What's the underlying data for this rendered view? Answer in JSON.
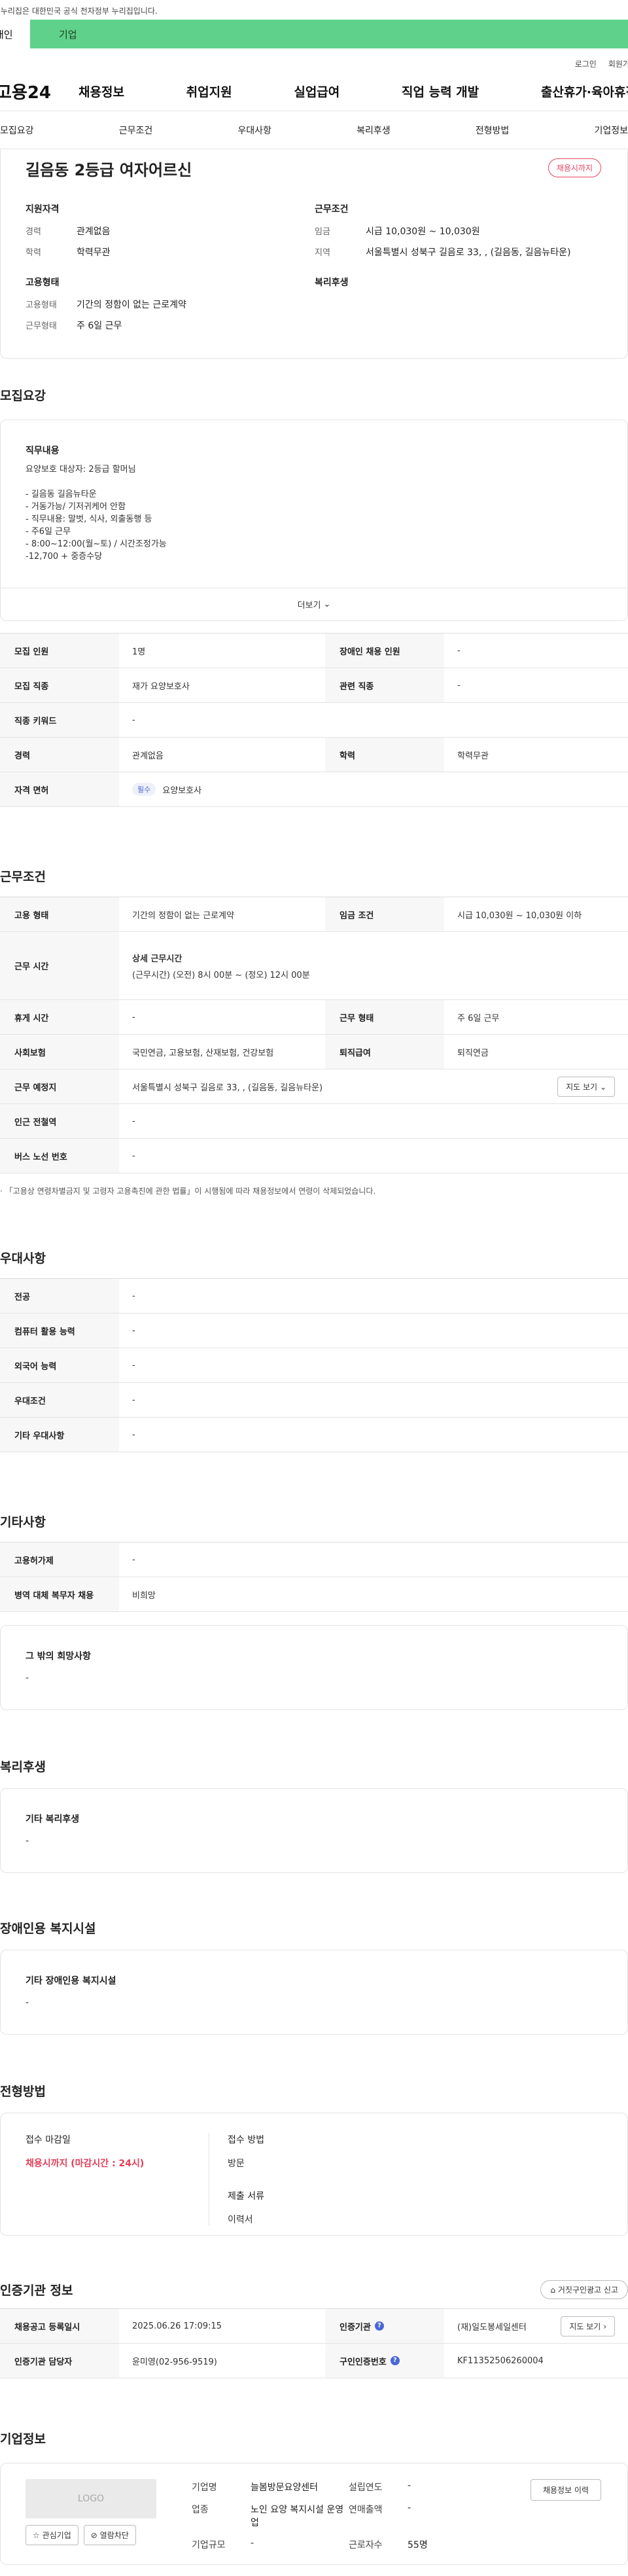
{
  "banner": {
    "text": "이 누리집은 대한민국 공식 전자정부 누리집입니다."
  },
  "tabs": {
    "person": "개인",
    "company": "기업"
  },
  "util": {
    "login": "로그인",
    "join": "회원가입"
  },
  "gnb": {
    "logo": "고용24",
    "items": [
      "채용정보",
      "취업지원",
      "실업급여",
      "직업 능력 개발",
      "출산휴가·육아휴직"
    ]
  },
  "subnav": [
    "모집요강",
    "근무조건",
    "우대사항",
    "복리후생",
    "전형방법",
    "기업정보"
  ],
  "summary": {
    "title": "길음동 2등급 여자어르신",
    "deadline": "채용시까지",
    "qualification_head": "지원자격",
    "qual_rows": [
      {
        "k": "경력",
        "v": "관계없음"
      },
      {
        "k": "학력",
        "v": "학력무관"
      }
    ],
    "employment_head": "고용형태",
    "emp_rows": [
      {
        "k": "고용형태",
        "v": "기간의 정함이 없는 근로계약"
      },
      {
        "k": "근무형태",
        "v": "주 6일 근무"
      }
    ],
    "conditions_head": "근무조건",
    "cond_rows": [
      {
        "k": "임금",
        "v": "시급 10,030원 ~ 10,030원"
      },
      {
        "k": "지역",
        "v": "서울특별시 성북구 길음로 33, , (길음동, 길음뉴타운)"
      }
    ],
    "welfare_head": "복리후생"
  },
  "recruit": {
    "title": "모집요강",
    "job_head": "직무내용",
    "job_lines": [
      "요양보호 대상자:  2등급 할머님",
      "",
      "- 길음동 길음뉴타운",
      "- 거동가능/ 기저귀케어 안함",
      "- 직무내용: 말벗, 식사, 외출동행 등",
      "- 주6일 근무",
      "- 8:00~12:00(월~토) / 시간조정가능",
      "-12,700 + 중증수당"
    ],
    "more": "더보기",
    "rows": {
      "count_k": "모집 인원",
      "count_v": "1명",
      "disabled_k": "장애인 채용 인원",
      "disabled_v": "-",
      "job_k": "모집 직종",
      "job_v": "재가 요양보호사",
      "related_k": "관련 직종",
      "related_v": "-",
      "keyword_k": "직종 키워드",
      "keyword_v": "-",
      "career_k": "경력",
      "career_v": "관계없음",
      "edu_k": "학력",
      "edu_v": "학력무관",
      "license_k": "자격 면허",
      "license_chip": "필수",
      "license_v": "요양보호사"
    }
  },
  "conditions": {
    "title": "근무조건",
    "type_k": "고용 형태",
    "type_v": "기간의 정함이 없는 근로계약",
    "wage_k": "임금 조건",
    "wage_v": "시급 10,030원 ~ 10,030원 이하",
    "hours_k": "근무 시간",
    "hours_head": "상세 근무시간",
    "hours_v": "(근무시간) (오전) 8시 00분 ~ (정오) 12시 00분",
    "rest_k": "휴게 시간",
    "rest_v": "-",
    "form_k": "근무 형태",
    "form_v": "주 6일 근무",
    "insurance_k": "사회보험",
    "insurance_v": "국민연금, 고용보험, 산재보험, 건강보험",
    "retire_k": "퇴직급여",
    "retire_v": "퇴직연금",
    "place_k": "근무 예정지",
    "place_v": "서울특별시 성북구 길음로 33, , (길음동, 길음뉴타운)",
    "map": "지도 보기",
    "station_k": "인근 전철역",
    "station_v": "-",
    "bus_k": "버스 노선 번호",
    "bus_v": "-",
    "note": "「고용상 연령차별금지 및 고령자 고용촉진에 관한 법률」이 시행됨에 따라 채용정보에서 연령이 삭제되었습니다."
  },
  "preference": {
    "title": "우대사항",
    "rows": [
      {
        "k": "전공",
        "v": "-"
      },
      {
        "k": "컴퓨터 활용 능력",
        "v": "-"
      },
      {
        "k": "외국어 능력",
        "v": "-"
      },
      {
        "k": "우대조건",
        "v": "-"
      },
      {
        "k": "기타 우대사항",
        "v": "-"
      }
    ]
  },
  "other": {
    "title": "기타사항",
    "rows": [
      {
        "k": "고용허가제",
        "v": "-"
      },
      {
        "k": "병역 대체 복무자 채용",
        "v": "비희망"
      }
    ],
    "wish_head": "그 밖의 희망사항",
    "wish_v": "-"
  },
  "welfare": {
    "title": "복리후생",
    "head": "기타 복리후생",
    "v": "-"
  },
  "facility": {
    "title": "장애인용 복지시설",
    "head": "기타 장애인용 복지시설",
    "v": "-"
  },
  "selection": {
    "title": "전형방법",
    "deadline_head": "접수 마감일",
    "deadline_v": "채용시까지 (마감시간 : 24시)",
    "method_head": "접수 방법",
    "method_v": "방문",
    "docs_head": "제출 서류",
    "docs_v": "이력서"
  },
  "agency": {
    "title": "인증기관 정보",
    "report": "거짓구인광고 신고",
    "reg_k": "채용공고 등록일시",
    "reg_v": "2025.06.26 17:09:15",
    "cert_k": "인증기관",
    "cert_v": "(재)일도봉세일센터",
    "map": "지도 보기",
    "manager_k": "인증기관 담당자",
    "manager_v": "윤미영(02-956-9519)",
    "num_k": "구인인증번호",
    "num_v": "KF11352506260004"
  },
  "company": {
    "title": "기업정보",
    "logo": "LOGO",
    "fav": "관심기업",
    "block": "열람차단",
    "history": "채용정보 이력",
    "name_k": "기업명",
    "name_v": "늘봄방문요양센터",
    "year_k": "설립연도",
    "year_v": "-",
    "biz_k": "업종",
    "biz_v": "노인 요양 복지시설 운영업",
    "sales_k": "연매출액",
    "sales_v": "-",
    "emp_k": "근로자수",
    "emp_v": "55명",
    "size_k": "기업규모",
    "size_v": "-"
  },
  "colors": {
    "accent_green": "#5fd18b",
    "deadline_red": "#e23e57",
    "chip_blue": "#4a67d6"
  }
}
